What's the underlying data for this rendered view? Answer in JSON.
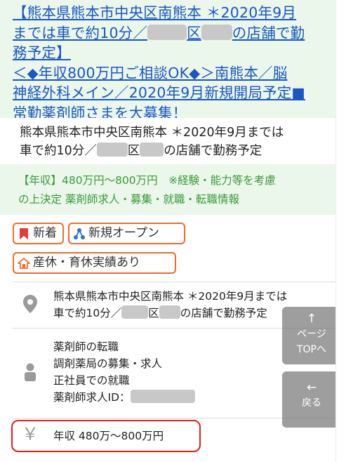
{
  "listing": {
    "title_line1": "【熊本県熊本市中央区南熊本 ＊2020年9月",
    "title_line2a": "までは車で約10分／",
    "title_line2b": "区",
    "title_line2c": "の店舗で勤",
    "title_line3": "務予定】",
    "title_line4": "＜◆年収800万円ご相談OK◆＞南熊本／脳",
    "title_line5": "神経外科メイン／2020年9月新規開局予定■",
    "title_line6": "常勤薬剤師さまを大募集！",
    "subtitle_line1": "熊本県熊本市中央区南熊本 ＊2020年9月までは",
    "subtitle_line2a": "車で約10分／",
    "subtitle_line2b": "区",
    "subtitle_line2c": "の店舗で勤務予定",
    "salary_note_line1": "【年収】480万円～800万円　※経験・能力等を考慮",
    "salary_note_line2": "の上決定 薬剤師求人・募集・就職・転職情報"
  },
  "badges": {
    "new": "新着",
    "new_open": "新規オープン",
    "maternity": "産休・育休実績あり"
  },
  "details": {
    "location_line1": "熊本県熊本市中央区南熊本 ＊2020年9月までは",
    "location_line2a": "車で約10分／",
    "location_line2b": "区",
    "location_line2c": "の店舗で勤務予定",
    "job_line1": "薬剤師の転職",
    "job_line2": "調剤薬局の募集・求人",
    "job_line3": "正社員での就職",
    "job_line4": "薬剤師求人ID：",
    "salary": "年収 480万～800万円",
    "yen_symbol": "￥"
  },
  "float_buttons": {
    "top_arrow": "↑",
    "top_label1": "ページ",
    "top_label2": "TOPへ",
    "back_arrow": "←",
    "back_label": "戻る"
  },
  "colors": {
    "link": "#1a56c4",
    "green_bg": "#eaf7ea",
    "green_text": "#3a9a3a",
    "badge_border": "#ef6c2a",
    "highlight": "#e01e1e"
  },
  "icons": {
    "new": "bookmark-flag-icon",
    "new_open": "network-nodes-icon",
    "maternity": "house-icon",
    "location": "map-pin-icon",
    "job": "person-icon",
    "salary": "yen-icon"
  }
}
